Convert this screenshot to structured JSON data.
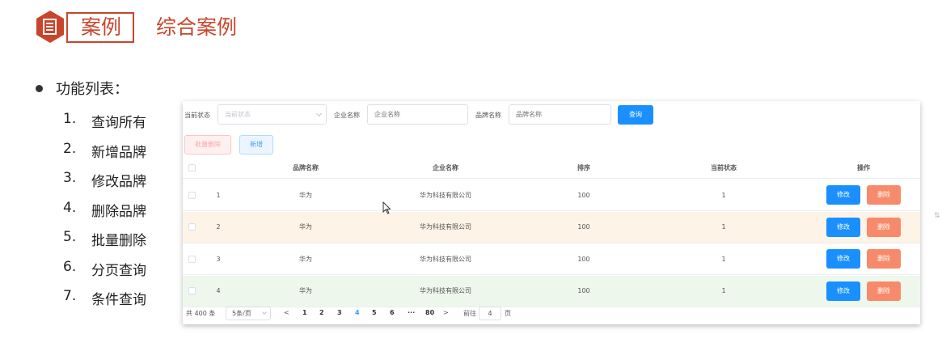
{
  "header": {
    "badge_icon": "document-icon",
    "tag": "案例",
    "title": "综合案例",
    "accent_color": "#c8452b"
  },
  "features": {
    "heading": "功能列表：",
    "items": [
      {
        "num": "1.",
        "label": "查询所有"
      },
      {
        "num": "2.",
        "label": "新增品牌"
      },
      {
        "num": "3.",
        "label": "修改品牌"
      },
      {
        "num": "4.",
        "label": "删除品牌"
      },
      {
        "num": "5.",
        "label": "批量删除"
      },
      {
        "num": "6.",
        "label": "分页查询"
      },
      {
        "num": "7.",
        "label": "条件查询"
      }
    ]
  },
  "filters": {
    "status_label": "当前状态",
    "status_placeholder": "当前状态",
    "company_label": "企业名称",
    "company_placeholder": "企业名称",
    "brand_label": "品牌名称",
    "brand_placeholder": "品牌名称",
    "query_button": "查询"
  },
  "actions": {
    "batch_delete": "批量删除",
    "add": "新增"
  },
  "table": {
    "headers": {
      "brand": "品牌名称",
      "company": "企业名称",
      "order": "排序",
      "status": "当前状态",
      "ops": "操作"
    },
    "edit_label": "修改",
    "delete_label": "删除",
    "rows": [
      {
        "index": "1",
        "brand": "华为",
        "company": "华为科技有限公司",
        "order": "100",
        "status": "1",
        "bg": "#ffffff"
      },
      {
        "index": "2",
        "brand": "华为",
        "company": "华为科技有限公司",
        "order": "100",
        "status": "1",
        "bg": "#fdf3e7"
      },
      {
        "index": "3",
        "brand": "华为",
        "company": "华为科技有限公司",
        "order": "100",
        "status": "1",
        "bg": "#ffffff"
      },
      {
        "index": "4",
        "brand": "华为",
        "company": "华为科技有限公司",
        "order": "100",
        "status": "1",
        "bg": "#eef7ec"
      }
    ]
  },
  "pagination": {
    "total": "共 400 条",
    "page_size": "5条/页",
    "prev": "<",
    "pages": [
      "1",
      "2",
      "3",
      "4",
      "5",
      "6",
      "···",
      "80"
    ],
    "active_page": "4",
    "next": ">",
    "goto_label": "前往",
    "goto_value": "4",
    "page_suffix": "页"
  }
}
